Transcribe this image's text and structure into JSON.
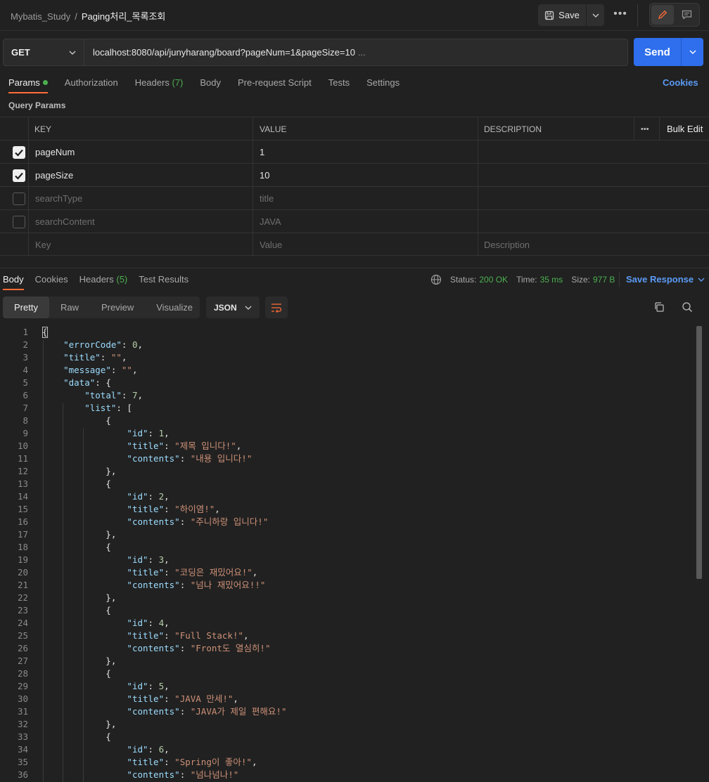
{
  "topbar": {
    "parent": "Mybatis_Study",
    "separator": "/",
    "current": "Paging처리_목록조회",
    "save_label": "Save"
  },
  "request": {
    "method": "GET",
    "url": "localhost:8080/api/junyharang/board?pageNum=1&pageSize=10",
    "url_ellipsis": "...",
    "send_label": "Send"
  },
  "request_tabs": [
    {
      "label": "Params",
      "count": ""
    },
    {
      "label": "Authorization",
      "count": ""
    },
    {
      "label": "Headers",
      "count": "(7)"
    },
    {
      "label": "Body",
      "count": ""
    },
    {
      "label": "Pre-request Script",
      "count": ""
    },
    {
      "label": "Tests",
      "count": ""
    },
    {
      "label": "Settings",
      "count": ""
    }
  ],
  "cookies_label": "Cookies",
  "query_params_title": "Query Params",
  "params_table": {
    "headers": {
      "key": "KEY",
      "value": "VALUE",
      "description": "DESCRIPTION",
      "more": "•••",
      "bulk_edit": "Bulk Edit"
    },
    "rows": [
      {
        "checked": true,
        "key": "pageNum",
        "value": "1",
        "description": ""
      },
      {
        "checked": true,
        "key": "pageSize",
        "value": "10",
        "description": ""
      },
      {
        "checked": false,
        "key": "searchType",
        "value": "title",
        "description": ""
      },
      {
        "checked": false,
        "key": "searchContent",
        "value": "JAVA",
        "description": ""
      }
    ],
    "placeholder": {
      "key": "Key",
      "value": "Value",
      "description": "Description"
    }
  },
  "response_tabs": [
    {
      "label": "Body",
      "count": ""
    },
    {
      "label": "Cookies",
      "count": ""
    },
    {
      "label": "Headers",
      "count": "(5)"
    },
    {
      "label": "Test Results",
      "count": ""
    }
  ],
  "status": {
    "status_label": "Status:",
    "status_value": "200 OK",
    "time_label": "Time:",
    "time_value": "35 ms",
    "size_label": "Size:",
    "size_value": "977 B"
  },
  "save_response_label": "Save Response",
  "view_tabs": [
    "Pretty",
    "Raw",
    "Preview",
    "Visualize"
  ],
  "format": "JSON",
  "code_lines": [
    "{",
    "    \"errorCode\": 0,",
    "    \"title\": \"\",",
    "    \"message\": \"\",",
    "    \"data\": {",
    "        \"total\": 7,",
    "        \"list\": [",
    "            {",
    "                \"id\": 1,",
    "                \"title\": \"제목 입니다!\",",
    "                \"contents\": \"내용 입니다!\"",
    "            },",
    "            {",
    "                \"id\": 2,",
    "                \"title\": \"하이염!\",",
    "                \"contents\": \"주니하랑 입니다!\"",
    "            },",
    "            {",
    "                \"id\": 3,",
    "                \"title\": \"코딩은 재밌어요!\",",
    "                \"contents\": \"넘나 재밌어요!!\"",
    "            },",
    "            {",
    "                \"id\": 4,",
    "                \"title\": \"Full Stack!\",",
    "                \"contents\": \"Front도 열심히!\"",
    "            },",
    "            {",
    "                \"id\": 5,",
    "                \"title\": \"JAVA 만세!\",",
    "                \"contents\": \"JAVA가 제일 편해요!\"",
    "            },",
    "            {",
    "                \"id\": 6,",
    "                \"title\": \"Spring이 좋아!\",",
    "                \"contents\": \"넘나넘나!\""
  ],
  "colors": {
    "accent": "#ff6c37",
    "send": "#2f6fed",
    "link": "#5b9bf5",
    "ok": "#4caf50"
  }
}
